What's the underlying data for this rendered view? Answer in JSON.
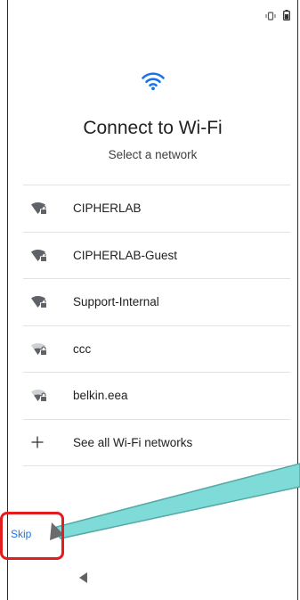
{
  "status_icons": [
    "vibrate-icon",
    "battery-icon"
  ],
  "header": {
    "icon": "wifi-icon",
    "title": "Connect to Wi-Fi",
    "subtitle": "Select a network"
  },
  "networks": [
    {
      "name": "CIPHERLAB",
      "icon": "wifi-lock-strong-icon"
    },
    {
      "name": "CIPHERLAB-Guest",
      "icon": "wifi-lock-strong-icon"
    },
    {
      "name": "Support-Internal",
      "icon": "wifi-lock-strong-icon"
    },
    {
      "name": "ccc",
      "icon": "wifi-lock-weak-icon"
    },
    {
      "name": "belkin.eea",
      "icon": "wifi-lock-weak-icon"
    }
  ],
  "see_all": {
    "label": "See all Wi-Fi networks",
    "icon": "plus-icon"
  },
  "skip_label": "Skip",
  "nav": {
    "back_icon": "back-triangle-icon"
  },
  "colors": {
    "accent": "#1a73e8",
    "callout": "#e41c1c",
    "arrow": "#7fdbd8"
  }
}
